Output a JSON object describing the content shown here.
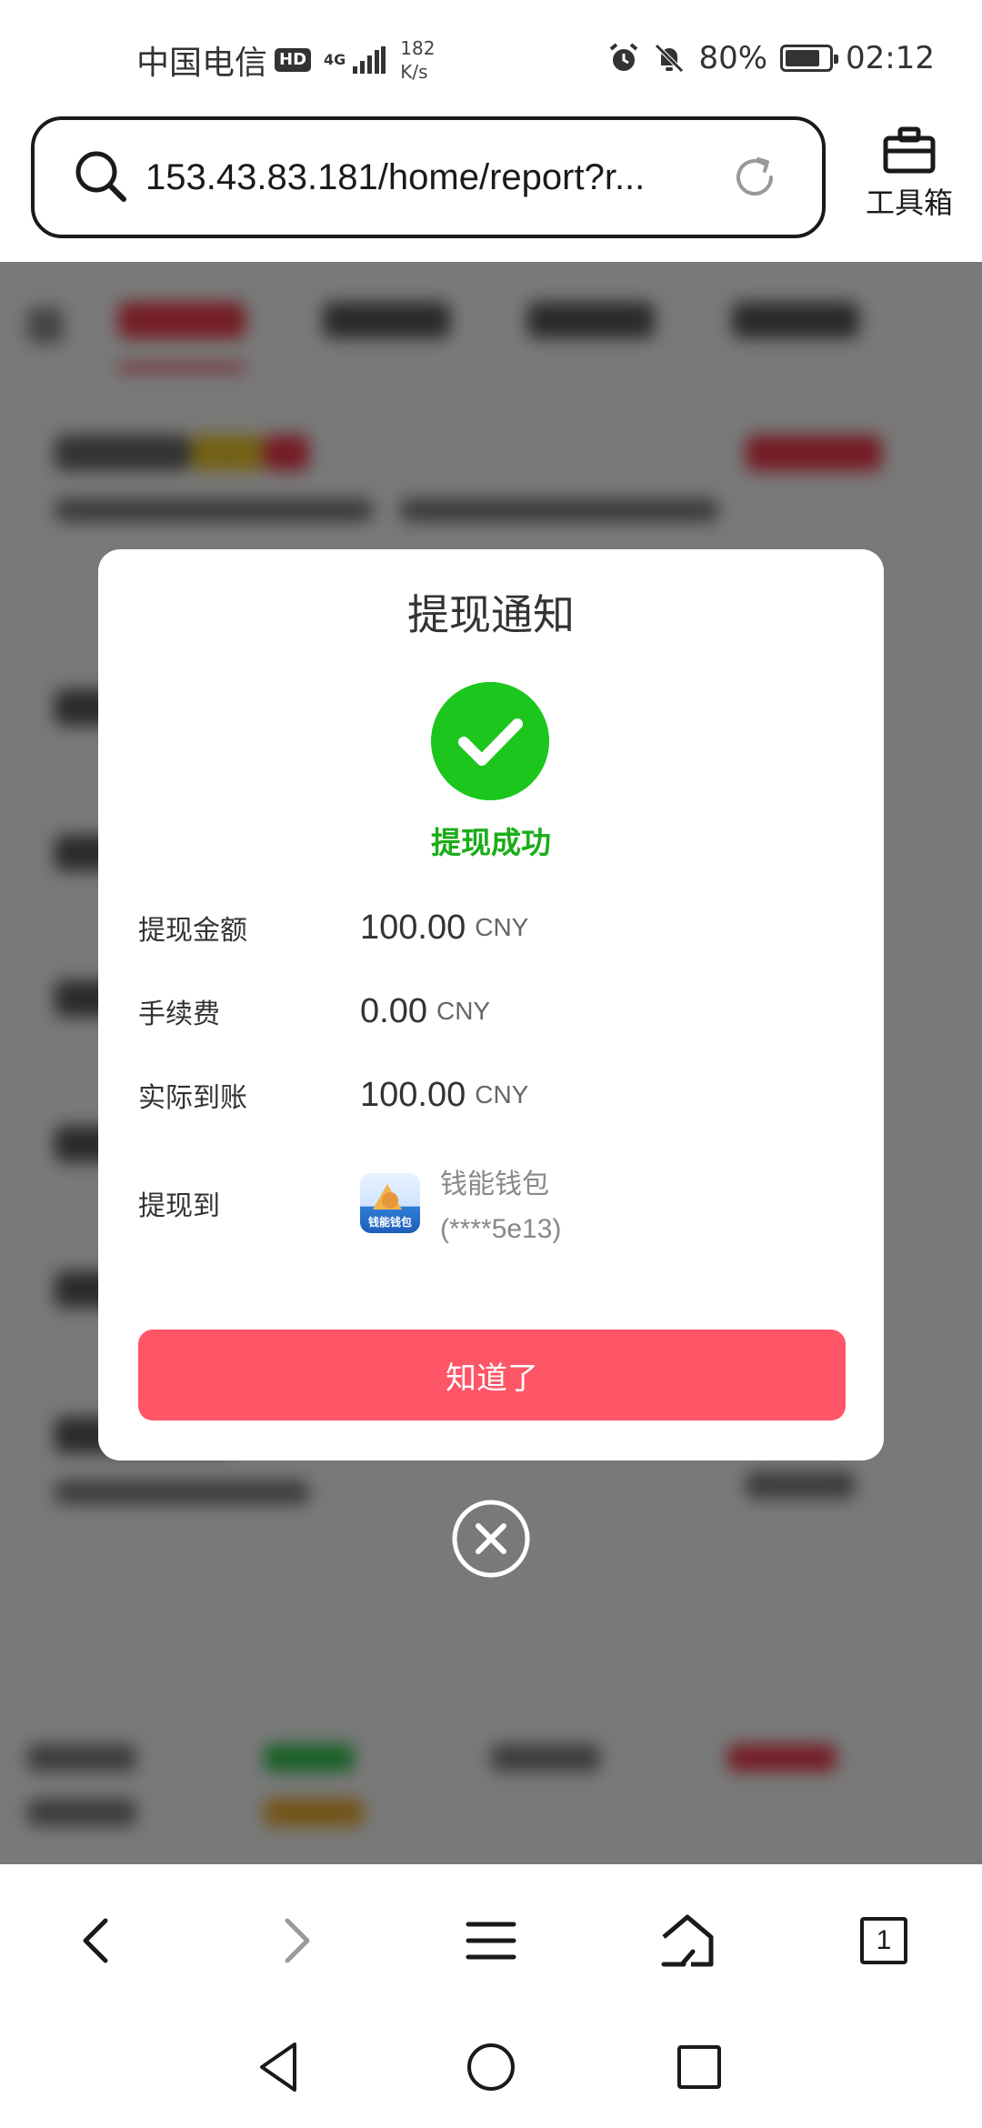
{
  "status_bar": {
    "carrier": "中国电信",
    "hd_badge": "HD",
    "network": "4G",
    "net_speed_value": "182",
    "net_speed_unit": "K/s",
    "battery_percent_text": "80%",
    "battery_level": 0.8,
    "time": "02:12"
  },
  "browser": {
    "url": "153.43.83.181/home/report?r...",
    "toolbox_label": "工具箱",
    "tab_count": "1"
  },
  "dialog": {
    "title": "提现通知",
    "status_text": "提现成功",
    "rows": [
      {
        "label": "提现金额",
        "value": "100.00",
        "unit": "CNY"
      },
      {
        "label": "手续费",
        "value": "0.00",
        "unit": "CNY"
      },
      {
        "label": "实际到账",
        "value": "100.00",
        "unit": "CNY"
      }
    ],
    "destination_label": "提现到",
    "wallet_name": "钱能钱包",
    "wallet_account": "(****5e13)",
    "wallet_logo_text": "钱能钱包",
    "confirm_label": "知道了"
  },
  "colors": {
    "success_green": "#1cc61c",
    "confirm_button": "#fe5567",
    "overlay": "rgba(0,0,0,0.5)"
  },
  "icons": {
    "search": "search-icon",
    "refresh": "refresh-icon",
    "toolbox": "briefcase-icon",
    "success": "checkmark-icon",
    "close": "close-circle-icon",
    "back": "chevron-left-icon",
    "forward": "chevron-right-icon",
    "menu": "hamburger-menu-icon",
    "home": "home-icon",
    "sys_back": "triangle-back-icon",
    "sys_home": "circle-home-icon",
    "sys_recent": "square-recent-icon"
  }
}
